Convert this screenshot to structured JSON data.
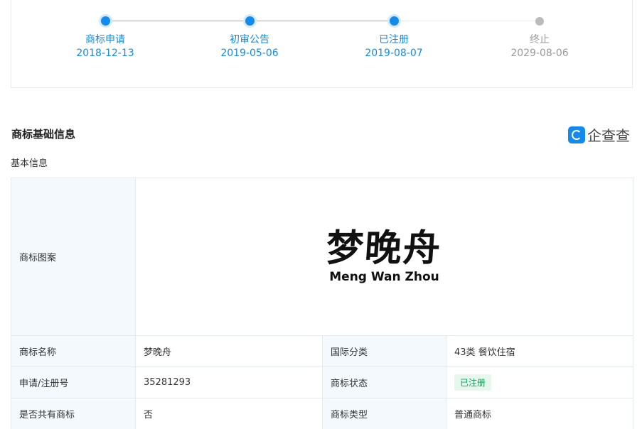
{
  "timeline": [
    {
      "label": "商标申请",
      "date": "2018-12-13",
      "state": "done"
    },
    {
      "label": "初审公告",
      "date": "2019-05-06",
      "state": "done"
    },
    {
      "label": "已注册",
      "date": "2019-08-07",
      "state": "done"
    },
    {
      "label": "终止",
      "date": "2029-08-06",
      "state": "future"
    }
  ],
  "section": {
    "title": "商标基础信息",
    "sub_title": "基本信息"
  },
  "brand": {
    "name": "企查查",
    "color": "#128bed"
  },
  "mark": {
    "label": "商标图案",
    "cn": "梦晚舟",
    "en": "Meng Wan Zhou"
  },
  "rows": [
    {
      "l1": "商标名称",
      "v1": "梦晚舟",
      "l2": "国际分类",
      "v2": "43类 餐饮住宿"
    },
    {
      "l1": "申请/注册号",
      "v1": "35281293",
      "l2": "商标状态",
      "v2": "已注册"
    },
    {
      "l1": "是否共有商标",
      "v1": "否",
      "l2": "商标类型",
      "v2": "普通商标"
    }
  ]
}
